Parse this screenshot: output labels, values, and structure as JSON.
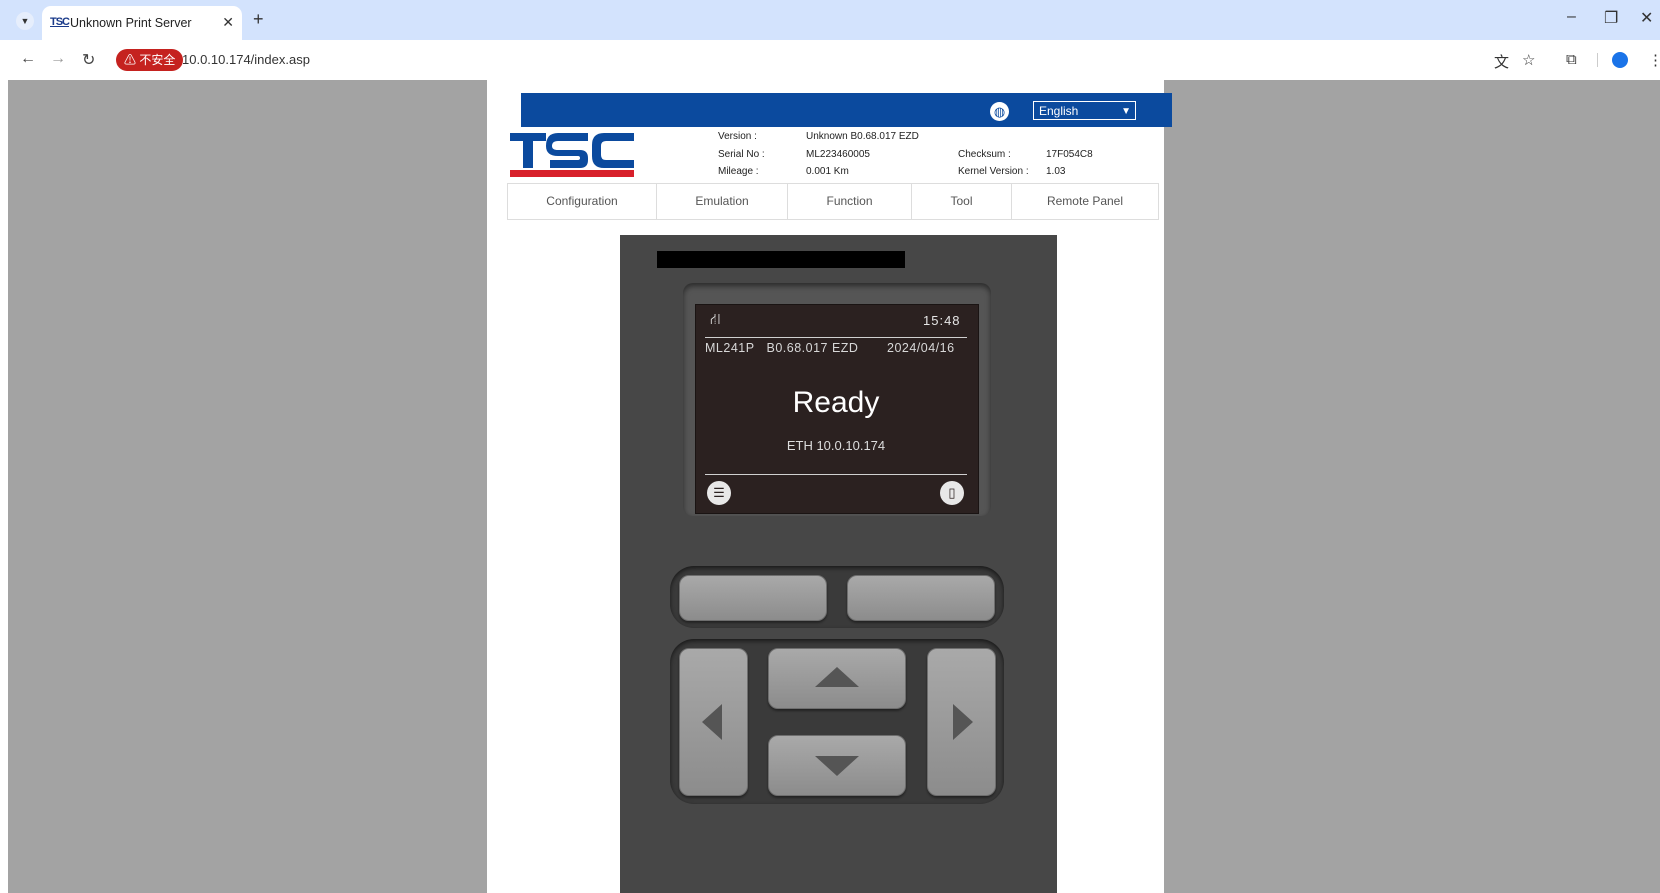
{
  "browser": {
    "tab_title": "Unknown Print Server",
    "tab_favicon": "TSC",
    "security_label": "⚠ 不安全",
    "url": "10.0.10.174/index.asp"
  },
  "header": {
    "language": "English",
    "brand_logo": "TSC",
    "info": {
      "version_label": "Version :",
      "version_value": "Unknown B0.68.017 EZD",
      "serial_label": "Serial No :",
      "serial_value": "ML223460005",
      "mileage_label": "Mileage :",
      "mileage_value": "0.001 Km",
      "checksum_label": "Checksum :",
      "checksum_value": "17F054C8",
      "kernel_label": "Kernel Version :",
      "kernel_value": "1.03"
    }
  },
  "menu": {
    "items": [
      {
        "label": "Configuration"
      },
      {
        "label": "Emulation"
      },
      {
        "label": "Function"
      },
      {
        "label": "Tool"
      },
      {
        "label": "Remote Panel"
      }
    ]
  },
  "lcd": {
    "time": "15:48",
    "model": "ML241P",
    "firmware": "B0.68.017 EZD",
    "date": "2024/04/16",
    "status": "Ready",
    "ip": "ETH 10.0.10.174"
  },
  "colors": {
    "brand_blue": "#0b4a9e",
    "brand_red": "#d8202a",
    "insecure_red": "#c5221f"
  }
}
